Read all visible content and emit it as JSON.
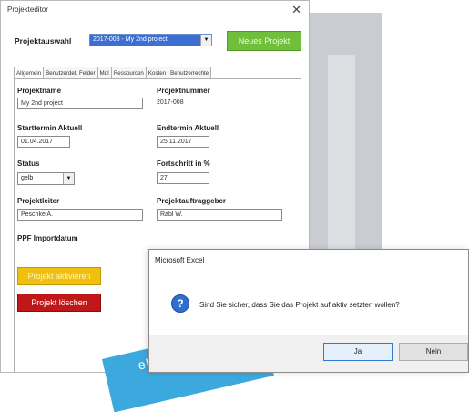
{
  "editor": {
    "title": "Projekteditor",
    "close_glyph": "✕",
    "projektauswahl_label": "Projektauswahl",
    "projektauswahl_value": "2017-008 - My 2nd project",
    "neues_projekt_label": "Neues Projekt",
    "tabs": [
      "Allgemein",
      "Benutzerdef. Felder",
      "MdI",
      "Ressourcen",
      "Kosten",
      "Benutzerrechte"
    ],
    "fields": {
      "projektname_label": "Projektname",
      "projektname_value": "My 2nd project",
      "projektnummer_label": "Projektnummer",
      "projektnummer_value": "2017-008",
      "starttermin_label": "Starttermin Aktuell",
      "starttermin_value": "01.04.2017",
      "endtermin_label": "Endtermin Aktuell",
      "endtermin_value": "25.11.2017",
      "status_label": "Status",
      "status_value": "gelb",
      "fortschritt_label": "Fortschritt in %",
      "fortschritt_value": "27",
      "projektleiter_label": "Projektleiter",
      "projektleiter_value": "Peschke A.",
      "auftraggeber_label": "Projektauftraggeber",
      "auftraggeber_value": "Rabl W.",
      "ppf_label": "PPF Importdatum"
    },
    "aktivieren_label": "Projekt aktivieren",
    "loeschen_label": "Projekt löschen"
  },
  "banner": {
    "text": "ektor"
  },
  "dialog": {
    "title": "Microsoft Excel",
    "icon": "question-icon",
    "icon_glyph": "?",
    "message": "Sind Sie sicher, dass Sie das Projekt auf aktiv setzten wollen?",
    "ja_label": "Ja",
    "nein_label": "Nein"
  },
  "colors": {
    "green_button": "#6fbe3c",
    "yellow_button": "#f0c010",
    "red_button": "#c01818",
    "banner": "#3ca9de",
    "dialog_icon": "#2e6fd0"
  }
}
